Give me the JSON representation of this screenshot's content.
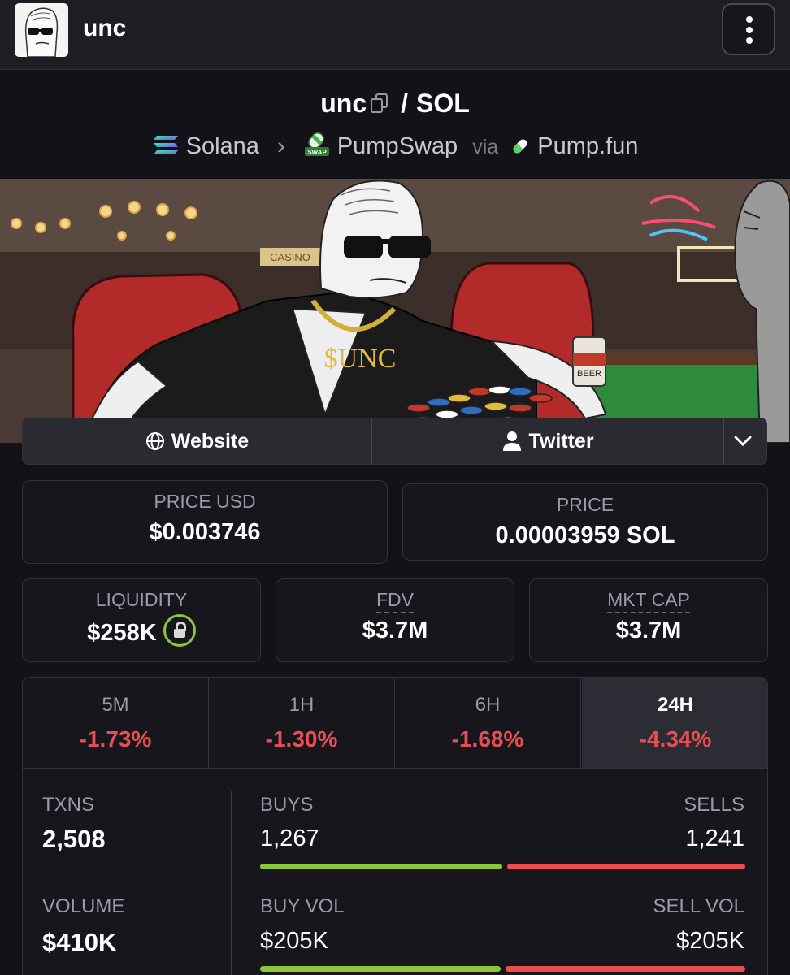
{
  "header": {
    "app_name": "unc"
  },
  "pair": {
    "base": "unc",
    "slash": "/",
    "quote": "SOL",
    "chain": "Solana",
    "dex": "PumpSwap",
    "dex_badge": "SWAP",
    "via": "via",
    "launchpad": "Pump.fun"
  },
  "banner": {
    "shirt_text": "$UNC",
    "can_text": "BEER",
    "sign_text": "CASINO"
  },
  "socials": {
    "website": "Website",
    "twitter": "Twitter"
  },
  "price": {
    "usd_label": "PRICE USD",
    "usd_value": "$0.003746",
    "sol_label": "PRICE",
    "sol_value": "0.00003959 SOL"
  },
  "metrics": {
    "liquidity_label": "LIQUIDITY",
    "liquidity_value": "$258K",
    "fdv_label": "FDV",
    "fdv_value": "$3.7M",
    "mcap_label": "MKT CAP",
    "mcap_value": "$3.7M"
  },
  "changes": [
    {
      "label": "5M",
      "value": "-1.73%"
    },
    {
      "label": "1H",
      "value": "-1.30%"
    },
    {
      "label": "6H",
      "value": "-1.68%"
    },
    {
      "label": "24H",
      "value": "-4.34%"
    }
  ],
  "activity": {
    "txns_label": "TXNS",
    "txns_value": "2,508",
    "volume_label": "VOLUME",
    "volume_value": "$410K",
    "buys_label": "BUYS",
    "buys_value": "1,267",
    "sells_label": "SELLS",
    "sells_value": "1,241",
    "buy_vol_label": "BUY VOL",
    "buy_vol_value": "$205K",
    "sell_vol_label": "SELL VOL",
    "sell_vol_value": "$205K",
    "buys_share": 0.505,
    "buy_vol_share": 0.5
  },
  "colors": {
    "positive": "#8cc63f",
    "negative": "#ea4e53",
    "background": "#121218"
  }
}
